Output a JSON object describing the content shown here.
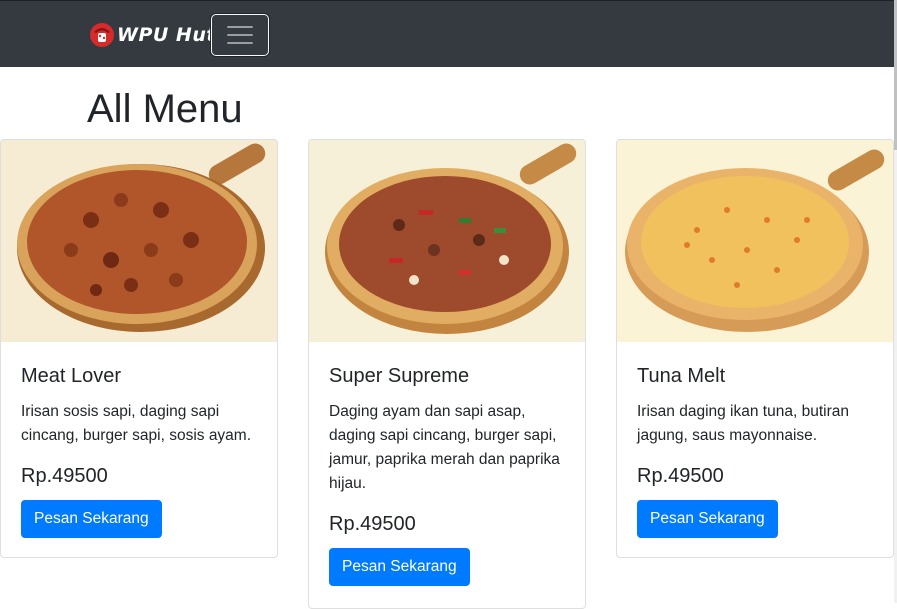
{
  "navbar": {
    "brand_name": "WPU Hut",
    "brand_icon": "pizza-logo-icon",
    "toggler_icon": "hamburger-menu-icon",
    "background": "#343a40"
  },
  "page": {
    "title": "All Menu"
  },
  "menu": {
    "items": [
      {
        "name": "Meat Lover",
        "description": "Irisan sosis sapi, daging sapi cincang, burger sapi, sosis ayam.",
        "price": "Rp.49500",
        "button_label": "Pesan Sekarang",
        "image": "meat-lover-pizza-image"
      },
      {
        "name": "Super Supreme",
        "description": "Daging ayam dan sapi asap, daging sapi cincang, burger sapi, jamur, paprika merah dan paprika hijau.",
        "price": "Rp.49500",
        "button_label": "Pesan Sekarang",
        "image": "super-supreme-pizza-image"
      },
      {
        "name": "Tuna Melt",
        "description": "Irisan daging ikan tuna, butiran jagung, saus mayonnaise.",
        "price": "Rp.49500",
        "button_label": "Pesan Sekarang",
        "image": "tuna-melt-pizza-image"
      }
    ]
  },
  "colors": {
    "primary_button": "#007bff",
    "navbar": "#343a40",
    "text": "#212529"
  }
}
